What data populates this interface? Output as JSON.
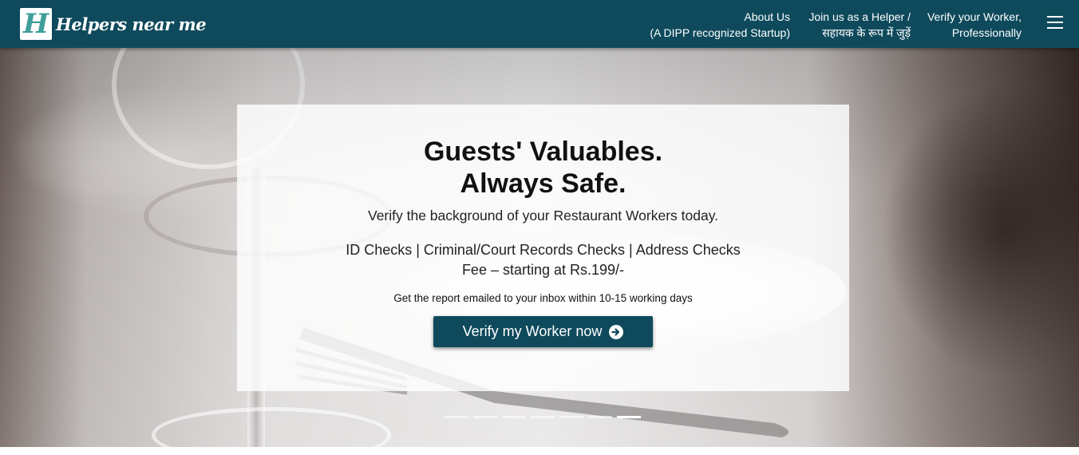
{
  "brand": {
    "logo_letter": "H",
    "name": "Helpers near me"
  },
  "nav": {
    "about": {
      "line1": "About Us",
      "line2": "(A DIPP recognized Startup)"
    },
    "join": {
      "line1": "Join us as a Helper /",
      "line2": "सहायक के रूप में जुड़ें"
    },
    "verify": {
      "line1": "Verify your Worker,",
      "line2": "Professionally"
    },
    "menu_icon": "hamburger-icon"
  },
  "hero": {
    "title_line1": "Guests' Valuables.",
    "title_line2": "Always Safe.",
    "subtitle": "Verify the background of your Restaurant Workers today.",
    "checks": "ID Checks | Criminal/Court Records Checks | Address Checks",
    "fee": "Fee – starting at Rs.199/-",
    "note": "Get the report emailed to your inbox within 10-15 working days",
    "cta_label": "Verify my Worker now",
    "cta_icon": "arrow-circle-right-icon"
  },
  "carousel": {
    "slide_count": 7,
    "active_index": 6
  },
  "colors": {
    "navbar": "#0e4a5c",
    "logo_accent": "#3f9f9a",
    "button": "#0e4a5c"
  }
}
